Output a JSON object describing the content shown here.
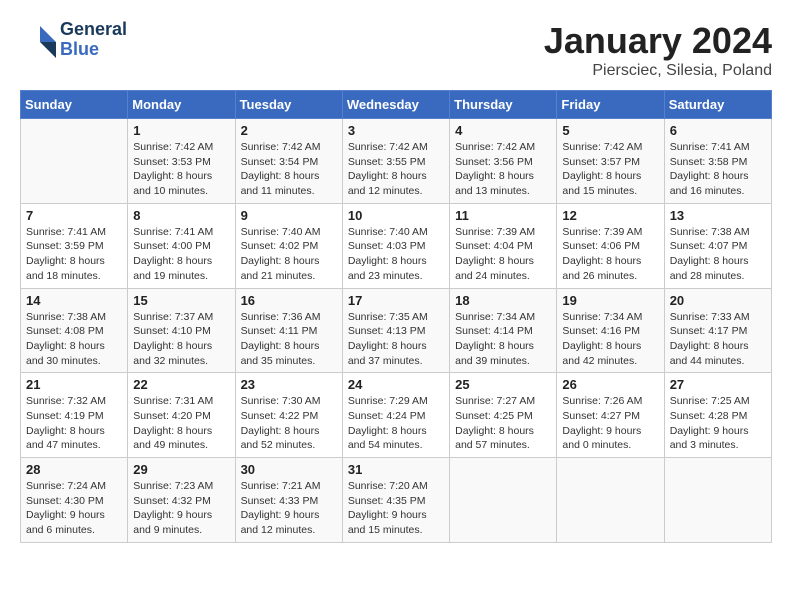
{
  "header": {
    "logo_line1": "General",
    "logo_line2": "Blue",
    "month_title": "January 2024",
    "location": "Piersciec, Silesia, Poland"
  },
  "days_of_week": [
    "Sunday",
    "Monday",
    "Tuesday",
    "Wednesday",
    "Thursday",
    "Friday",
    "Saturday"
  ],
  "weeks": [
    [
      {
        "day": "",
        "info": ""
      },
      {
        "day": "1",
        "info": "Sunrise: 7:42 AM\nSunset: 3:53 PM\nDaylight: 8 hours\nand 10 minutes."
      },
      {
        "day": "2",
        "info": "Sunrise: 7:42 AM\nSunset: 3:54 PM\nDaylight: 8 hours\nand 11 minutes."
      },
      {
        "day": "3",
        "info": "Sunrise: 7:42 AM\nSunset: 3:55 PM\nDaylight: 8 hours\nand 12 minutes."
      },
      {
        "day": "4",
        "info": "Sunrise: 7:42 AM\nSunset: 3:56 PM\nDaylight: 8 hours\nand 13 minutes."
      },
      {
        "day": "5",
        "info": "Sunrise: 7:42 AM\nSunset: 3:57 PM\nDaylight: 8 hours\nand 15 minutes."
      },
      {
        "day": "6",
        "info": "Sunrise: 7:41 AM\nSunset: 3:58 PM\nDaylight: 8 hours\nand 16 minutes."
      }
    ],
    [
      {
        "day": "7",
        "info": "Sunrise: 7:41 AM\nSunset: 3:59 PM\nDaylight: 8 hours\nand 18 minutes."
      },
      {
        "day": "8",
        "info": "Sunrise: 7:41 AM\nSunset: 4:00 PM\nDaylight: 8 hours\nand 19 minutes."
      },
      {
        "day": "9",
        "info": "Sunrise: 7:40 AM\nSunset: 4:02 PM\nDaylight: 8 hours\nand 21 minutes."
      },
      {
        "day": "10",
        "info": "Sunrise: 7:40 AM\nSunset: 4:03 PM\nDaylight: 8 hours\nand 23 minutes."
      },
      {
        "day": "11",
        "info": "Sunrise: 7:39 AM\nSunset: 4:04 PM\nDaylight: 8 hours\nand 24 minutes."
      },
      {
        "day": "12",
        "info": "Sunrise: 7:39 AM\nSunset: 4:06 PM\nDaylight: 8 hours\nand 26 minutes."
      },
      {
        "day": "13",
        "info": "Sunrise: 7:38 AM\nSunset: 4:07 PM\nDaylight: 8 hours\nand 28 minutes."
      }
    ],
    [
      {
        "day": "14",
        "info": "Sunrise: 7:38 AM\nSunset: 4:08 PM\nDaylight: 8 hours\nand 30 minutes."
      },
      {
        "day": "15",
        "info": "Sunrise: 7:37 AM\nSunset: 4:10 PM\nDaylight: 8 hours\nand 32 minutes."
      },
      {
        "day": "16",
        "info": "Sunrise: 7:36 AM\nSunset: 4:11 PM\nDaylight: 8 hours\nand 35 minutes."
      },
      {
        "day": "17",
        "info": "Sunrise: 7:35 AM\nSunset: 4:13 PM\nDaylight: 8 hours\nand 37 minutes."
      },
      {
        "day": "18",
        "info": "Sunrise: 7:34 AM\nSunset: 4:14 PM\nDaylight: 8 hours\nand 39 minutes."
      },
      {
        "day": "19",
        "info": "Sunrise: 7:34 AM\nSunset: 4:16 PM\nDaylight: 8 hours\nand 42 minutes."
      },
      {
        "day": "20",
        "info": "Sunrise: 7:33 AM\nSunset: 4:17 PM\nDaylight: 8 hours\nand 44 minutes."
      }
    ],
    [
      {
        "day": "21",
        "info": "Sunrise: 7:32 AM\nSunset: 4:19 PM\nDaylight: 8 hours\nand 47 minutes."
      },
      {
        "day": "22",
        "info": "Sunrise: 7:31 AM\nSunset: 4:20 PM\nDaylight: 8 hours\nand 49 minutes."
      },
      {
        "day": "23",
        "info": "Sunrise: 7:30 AM\nSunset: 4:22 PM\nDaylight: 8 hours\nand 52 minutes."
      },
      {
        "day": "24",
        "info": "Sunrise: 7:29 AM\nSunset: 4:24 PM\nDaylight: 8 hours\nand 54 minutes."
      },
      {
        "day": "25",
        "info": "Sunrise: 7:27 AM\nSunset: 4:25 PM\nDaylight: 8 hours\nand 57 minutes."
      },
      {
        "day": "26",
        "info": "Sunrise: 7:26 AM\nSunset: 4:27 PM\nDaylight: 9 hours\nand 0 minutes."
      },
      {
        "day": "27",
        "info": "Sunrise: 7:25 AM\nSunset: 4:28 PM\nDaylight: 9 hours\nand 3 minutes."
      }
    ],
    [
      {
        "day": "28",
        "info": "Sunrise: 7:24 AM\nSunset: 4:30 PM\nDaylight: 9 hours\nand 6 minutes."
      },
      {
        "day": "29",
        "info": "Sunrise: 7:23 AM\nSunset: 4:32 PM\nDaylight: 9 hours\nand 9 minutes."
      },
      {
        "day": "30",
        "info": "Sunrise: 7:21 AM\nSunset: 4:33 PM\nDaylight: 9 hours\nand 12 minutes."
      },
      {
        "day": "31",
        "info": "Sunrise: 7:20 AM\nSunset: 4:35 PM\nDaylight: 9 hours\nand 15 minutes."
      },
      {
        "day": "",
        "info": ""
      },
      {
        "day": "",
        "info": ""
      },
      {
        "day": "",
        "info": ""
      }
    ]
  ]
}
